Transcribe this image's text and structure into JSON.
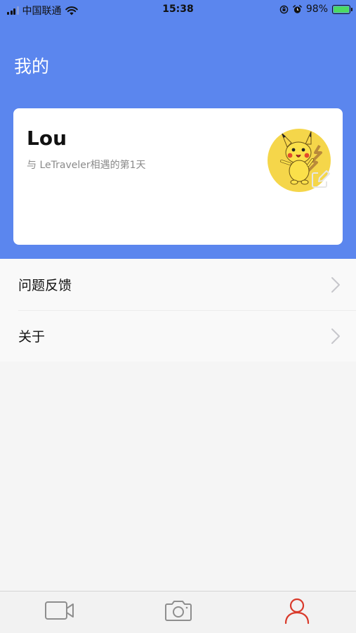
{
  "status_bar": {
    "carrier": "中国联通",
    "time": "15:38",
    "battery": "98%",
    "battery_level": 0.98,
    "icons": [
      "signal-icon",
      "wifi-icon",
      "orientation-lock-icon",
      "alarm-icon",
      "battery-icon"
    ]
  },
  "header": {
    "title": "我的"
  },
  "profile": {
    "name": "Lou",
    "subtitle": "与 LeTraveler相遇的第1天",
    "avatar_icon": "pikachu-avatar",
    "edit_icon": "edit-icon"
  },
  "menu": {
    "items": [
      {
        "label": "问题反馈",
        "icon": "chevron-right-icon"
      },
      {
        "label": "关于",
        "icon": "chevron-right-icon"
      }
    ]
  },
  "tab_bar": {
    "tabs": [
      {
        "icon": "video-camera-icon",
        "active": false
      },
      {
        "icon": "camera-icon",
        "active": false
      },
      {
        "icon": "person-icon",
        "active": true
      }
    ]
  },
  "colors": {
    "header_blue": "#5b86ee",
    "active_tab": "#d93a2b",
    "inactive_tab": "#8e8e8e",
    "battery_green": "#4cd964"
  }
}
